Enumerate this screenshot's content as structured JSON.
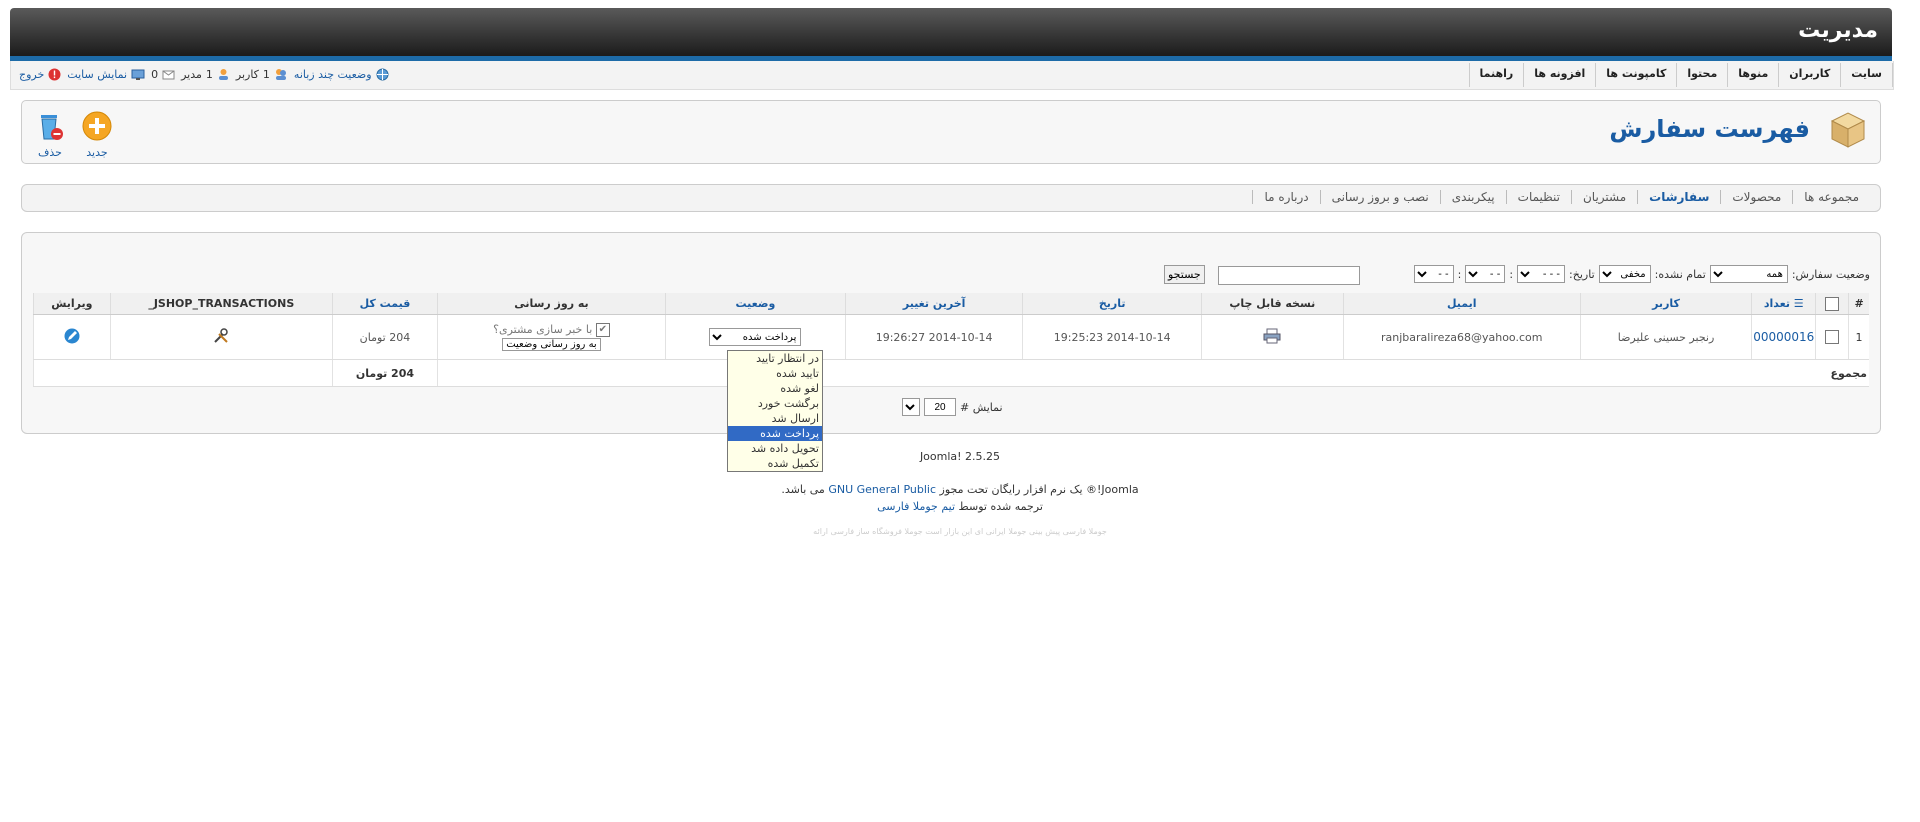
{
  "header": {
    "title": "مدیریت"
  },
  "menu": [
    "سایت",
    "کاربران",
    "منوها",
    "محتوا",
    "کامپونت ها",
    "افزونه ها",
    "راهنما"
  ],
  "status_bar": {
    "multilang": "وضعیت چند زبانه",
    "users_count": "1",
    "users_label": "کاربر",
    "admins_count": "1",
    "admins_label": "مدیر",
    "messages_count": "0",
    "view_site": "نمایش سایت",
    "logout": "خروج"
  },
  "toolbar": {
    "page_title": "فهرست سفارش",
    "new_label": "جدید",
    "delete_label": "حذف"
  },
  "submenu": [
    "مجموعه ها",
    "محصولات",
    "سفارشات",
    "مشتریان",
    "تنظیمات",
    "پیکربندی",
    "نصب و بروز رسانی",
    "درباره ما"
  ],
  "submenu_active": "سفارشات",
  "filters": {
    "order_status_label": "وضعیت سفارش:",
    "order_status_value": "همه",
    "unfinished_label": "تمام نشده:",
    "unfinished_value": "مخفی",
    "date_label": "تاریخ:",
    "date_day": "- -",
    "date_month": "- -",
    "date_year": "- - -",
    "search_button": "جستجو",
    "search_value": ""
  },
  "table": {
    "headers": [
      "#",
      "",
      "تعداد",
      "کاربر",
      "ایمیل",
      "نسخه قابل چاپ",
      "تاریخ",
      "آخرین تغییر",
      "وضعیت",
      "به روز رسانی",
      "قیمت کل",
      "JSHOP_TRANSACTIONS_",
      "ویرایش"
    ],
    "rows": [
      {
        "num": "1",
        "order_number": "00000016",
        "user": "رنجبر حسینی علیرضا",
        "email": "ranjbaralireza68@yahoo.com",
        "date": "2014-10-14 19:25:23",
        "last_modified": "2014-10-14 19:26:27",
        "status": "پرداخت شده",
        "notify_label": "با خبر سازی مشتری؟",
        "update_button": "به روز رسانی وضعیت",
        "total": "204 تومان"
      }
    ],
    "total_label": "مجموع",
    "total_value": "204 تومان"
  },
  "pager": {
    "label": "نمایش #",
    "value": "20"
  },
  "status_options": [
    "در انتظار تایید",
    "تایید شده",
    "لغو شده",
    "برگشت خورد",
    "ارسال شد",
    "پرداخت شده",
    "تحویل داده شد",
    "تکمیل شده"
  ],
  "status_selected_index": 5,
  "footer": {
    "version": "Joomla! 2.5.25",
    "license_prefix": "Joomla!® یک نرم افزار رایگان تحت مجوز",
    "license_link": "GNU General Public",
    "license_suffix": "می باشد.",
    "translated_by": "ترجمه شده توسط",
    "team_link": "تیم جوملا فارسی",
    "faint_text": "جوملا فارسی پیش بینی جوملا ایرانی ای این بازار است جوملا فروشگاه ساز فارسی ارائه"
  },
  "colors": {
    "accent": "#1a5ca3",
    "header_strip": "#1d6ba8",
    "dropdown_bg": "#ffffe8",
    "dropdown_selected": "#316ac5"
  }
}
